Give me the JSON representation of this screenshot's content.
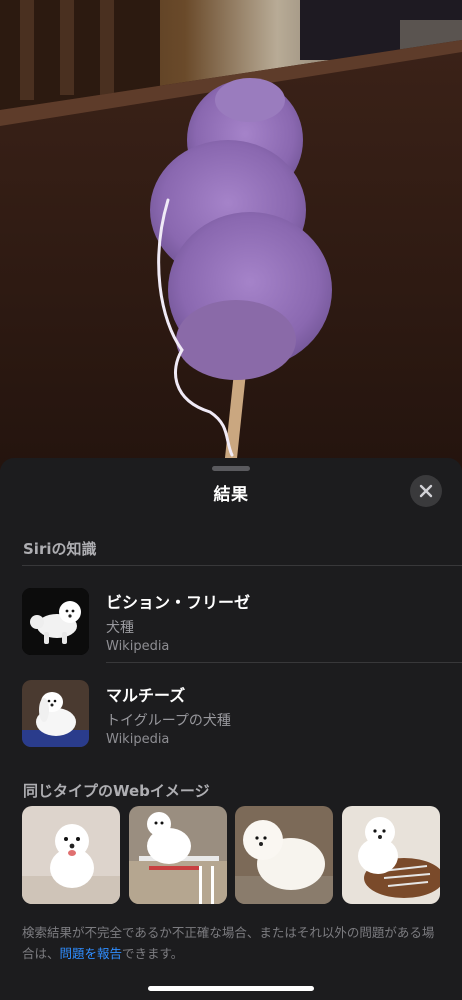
{
  "photo": {
    "subject": "cotton-candy"
  },
  "sheet": {
    "title": "結果",
    "close_icon": "close-x-icon"
  },
  "siri": {
    "header": "Siriの知識",
    "results": [
      {
        "name": "ビション・フリーゼ",
        "category": "犬種",
        "source": "Wikipedia"
      },
      {
        "name": "マルチーズ",
        "category": "トイグループの犬種",
        "source": "Wikipedia"
      }
    ]
  },
  "web": {
    "header": "同じタイプのWebイメージ",
    "image_count": 4
  },
  "footnote": {
    "before": "検索結果が不完全であるか不正確な場合、またはそれ以外の問題がある場合は、",
    "link": "問題を報告",
    "after": "できます。"
  },
  "colors": {
    "sheet_bg": "#1c1c1e",
    "link": "#2f8dff",
    "secondary_text": "#98989d"
  }
}
